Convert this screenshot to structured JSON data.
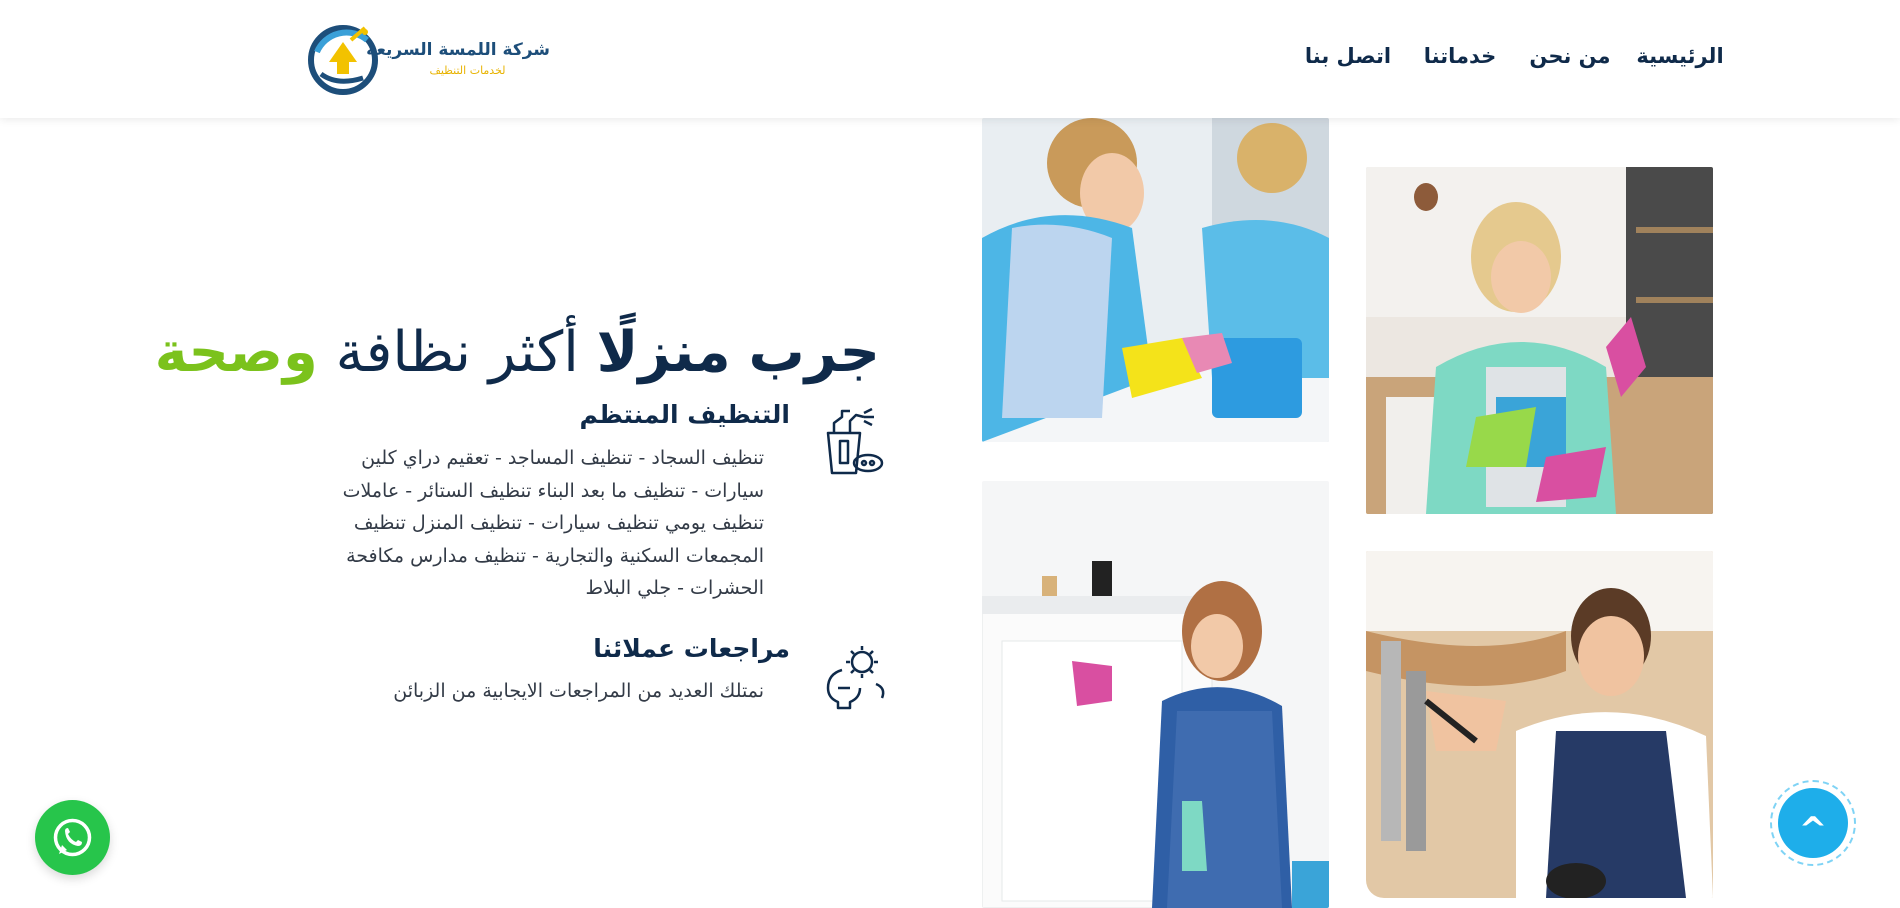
{
  "header": {
    "logo": {
      "name": "شركة اللمسة السريعة",
      "tagline": "لخدمات التنظيف"
    },
    "nav": [
      {
        "label": "الرئيسية"
      },
      {
        "label": "من نحن"
      },
      {
        "label": "خدماتنا"
      },
      {
        "label": "اتصل بنا"
      }
    ]
  },
  "hero": {
    "headline_part1": "جرب",
    "headline_part2": "منزلًا",
    "headline_part3": "أكثر نظافة",
    "headline_part4": "وصحة"
  },
  "features": [
    {
      "icon": "cleaning-supplies-icon",
      "title": "التنظيف المنتظم",
      "description": "تنظيف السجاد - تنظيف المساجد - تعقيم دراي كلين سيارات - تنظيف ما بعد البناء تنظيف الستائر - عاملات تنظيف يومي تنظيف سيارات - تنظيف المنزل تنظيف المجمعات السكنية والتجارية - تنظيف مدارس مكافحة الحشرات - جلي البلاط"
    },
    {
      "icon": "gear-lightbulb-icon",
      "title": "مراجعات عملائنا",
      "description": "نمتلك العديد من المراجعات الايجابية من الزبائن"
    }
  ],
  "floating": {
    "whatsapp_icon": "whatsapp-icon",
    "scroll_top_label": "^"
  },
  "colors": {
    "primary": "#0f2a4a",
    "accent_green": "#7bc21c",
    "scroll_top": "#1eaeea",
    "whatsapp": "#27c54b"
  }
}
